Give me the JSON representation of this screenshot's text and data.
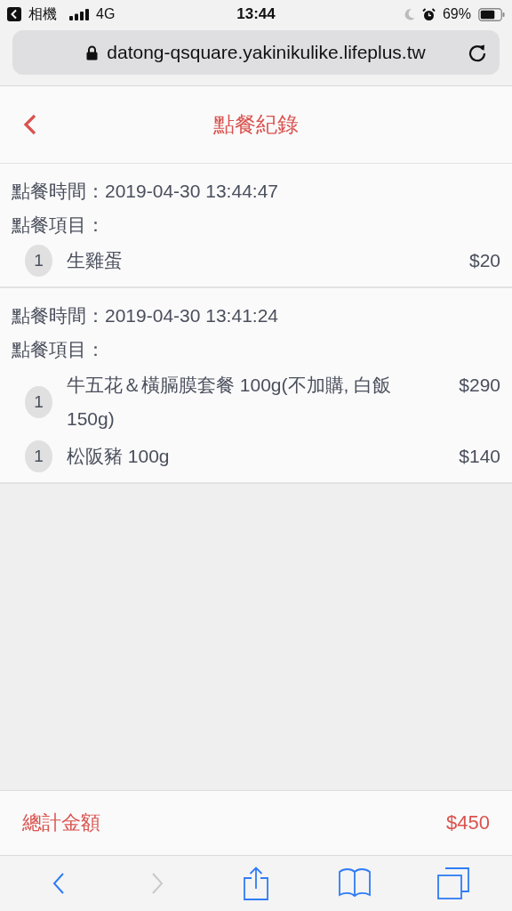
{
  "status_bar": {
    "back_app": "相機",
    "network": "4G",
    "time": "13:44",
    "battery": "69%"
  },
  "address_bar": {
    "url": "datong-qsquare.yakinikulike.lifeplus.tw"
  },
  "header": {
    "title": "點餐紀錄"
  },
  "orders": [
    {
      "time_label": "點餐時間：",
      "time": "2019-04-30 13:44:47",
      "items_label": "點餐項目：",
      "items": [
        {
          "qty": "1",
          "name": "生雞蛋",
          "price": "$20"
        }
      ]
    },
    {
      "time_label": "點餐時間：",
      "time": "2019-04-30 13:41:24",
      "items_label": "點餐項目：",
      "items": [
        {
          "qty": "1",
          "name": "牛五花＆橫膈膜套餐 100g(不加購, 白飯 150g)",
          "price": "$290"
        },
        {
          "qty": "1",
          "name": "松阪豬 100g",
          "price": "$140"
        }
      ]
    }
  ],
  "total": {
    "label": "總計金額",
    "amount": "$450"
  },
  "toolbar": [
    {
      "kind": "back",
      "disabled": false
    },
    {
      "kind": "forward",
      "disabled": true
    },
    {
      "kind": "share",
      "disabled": false
    },
    {
      "kind": "bookmarks",
      "disabled": false
    },
    {
      "kind": "tabs",
      "disabled": false
    }
  ]
}
